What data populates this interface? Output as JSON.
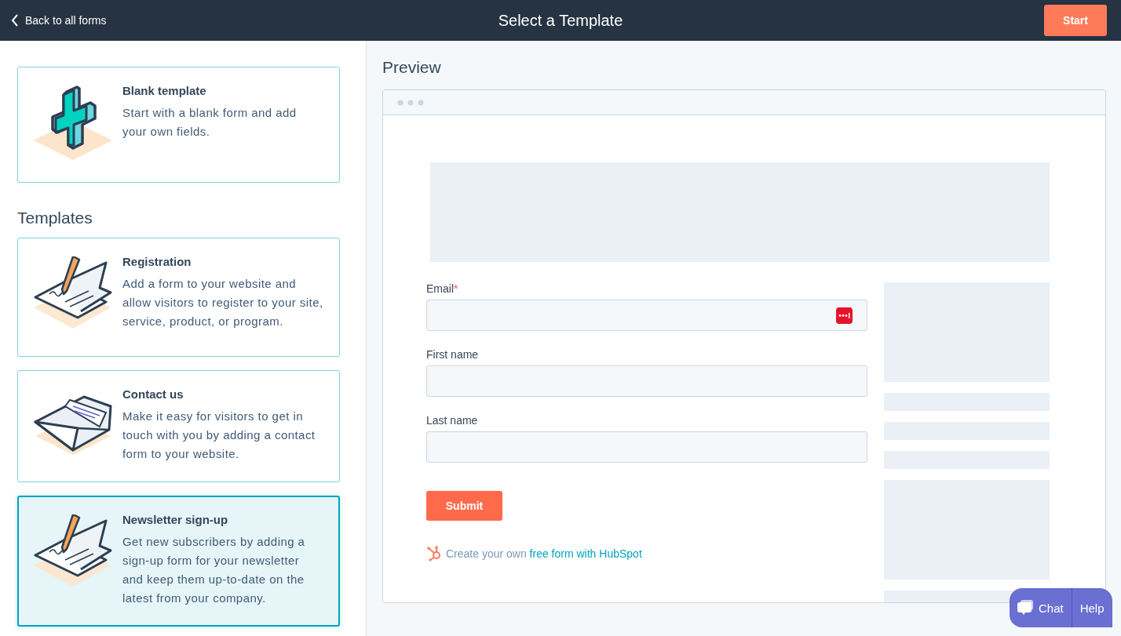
{
  "header": {
    "back_link": "Back to all forms",
    "title": "Select a Template",
    "start_button": "Start"
  },
  "blank_template": {
    "title": "Blank template",
    "description": "Start with a blank form and add your own fields."
  },
  "templates_heading": "Templates",
  "templates": [
    {
      "kind": "signature",
      "title": "Registration",
      "description": "Add a form to your website and allow visitors to register to your site, service, product, or program.",
      "selected": false
    },
    {
      "kind": "envelope",
      "title": "Contact us",
      "description": "Make it easy for visitors to get in touch with you by adding a contact form to your website.",
      "selected": false
    },
    {
      "kind": "signature",
      "title": "Newsletter sign-up",
      "description": "Get new subscribers by adding a sign-up form for your newsletter and keep them up-to-date on the latest from your company.",
      "selected": true
    }
  ],
  "preview": {
    "heading": "Preview",
    "fields": [
      {
        "label": "Email",
        "required_mark": "*",
        "autofill_icon": true
      },
      {
        "label": "First name",
        "autofill_icon": false
      },
      {
        "label": "Last name",
        "autofill_icon": false
      }
    ],
    "submit_button": "Submit",
    "footer_text": "Create your own ",
    "footer_link": "free form with HubSpot"
  },
  "chat_widget": {
    "chat": "Chat",
    "help": "Help"
  }
}
